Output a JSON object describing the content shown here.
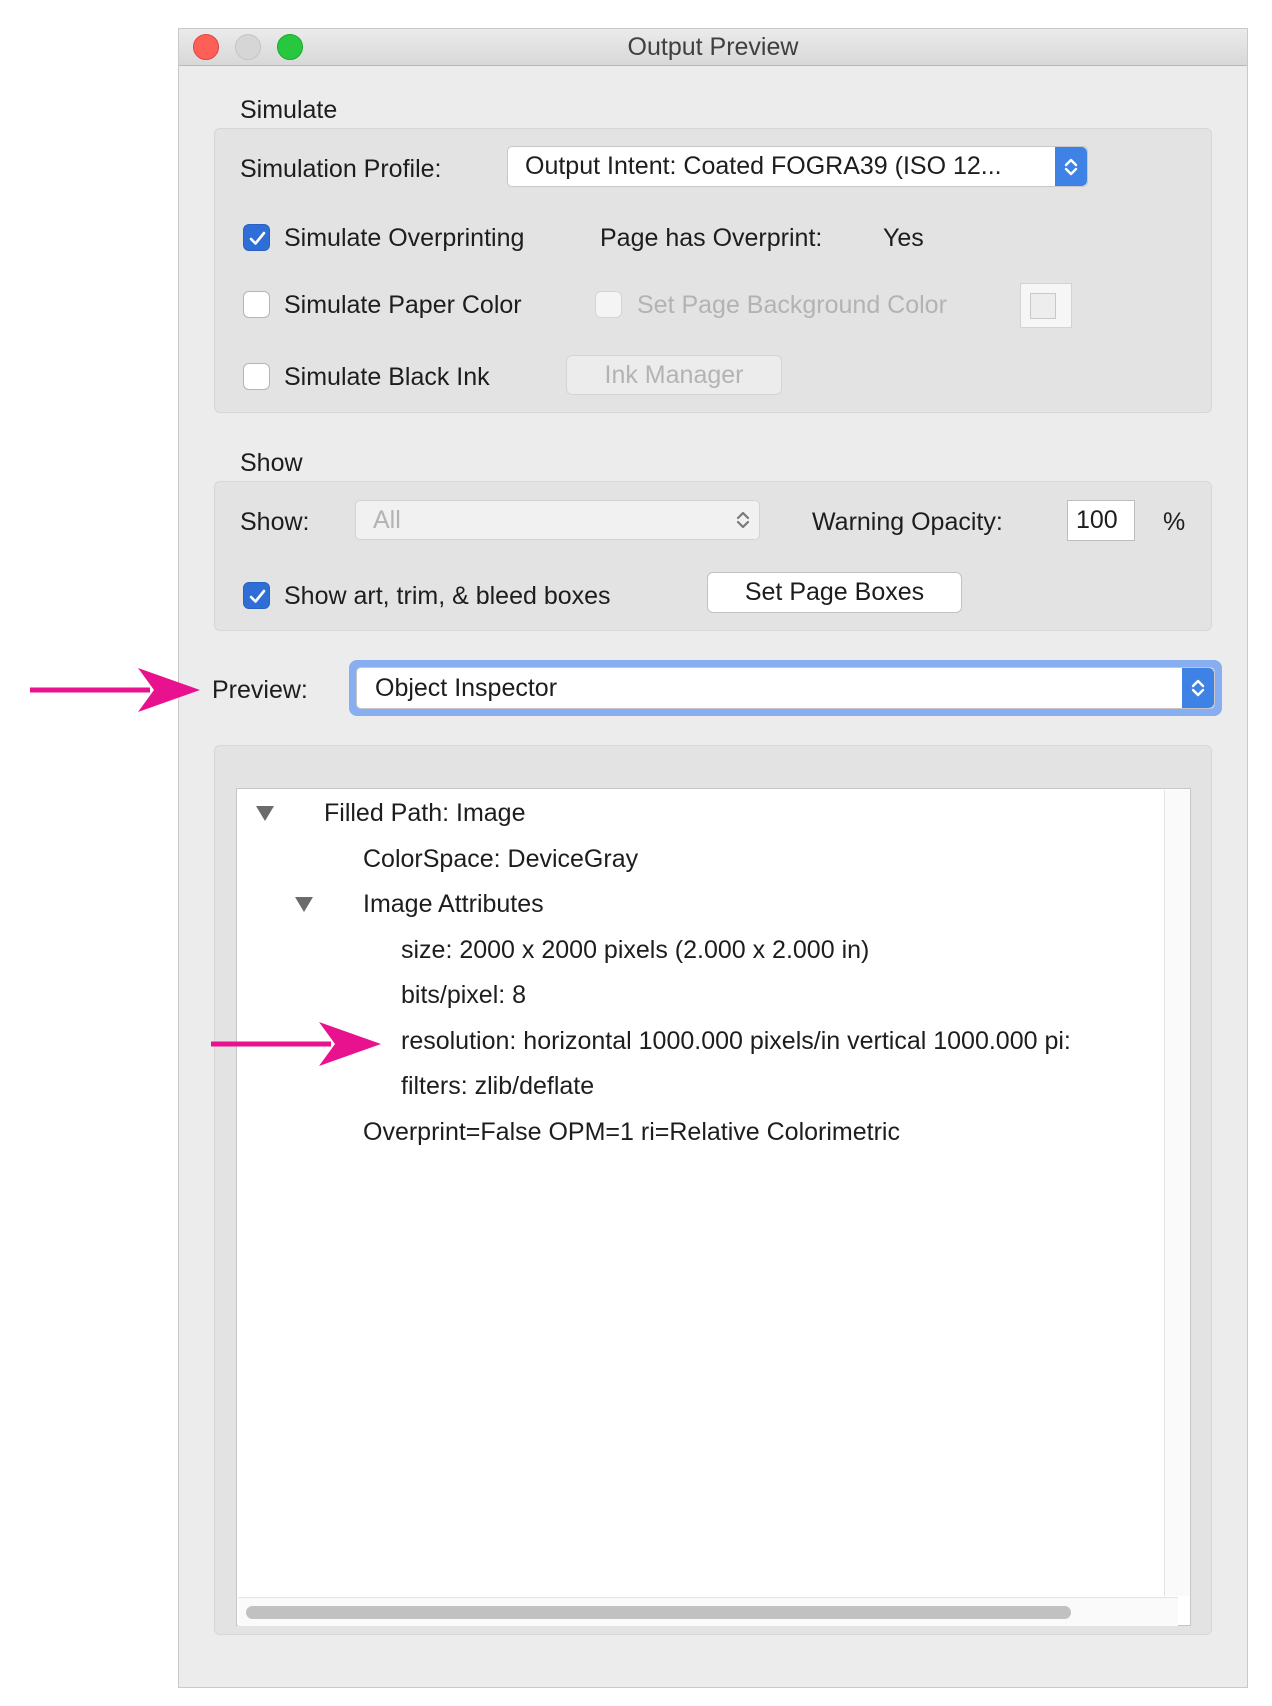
{
  "window": {
    "title": "Output Preview"
  },
  "simulate": {
    "section_label": "Simulate",
    "profile_label": "Simulation Profile:",
    "profile_value": "Output Intent: Coated FOGRA39 (ISO 12...",
    "overprinting": {
      "label": "Simulate Overprinting",
      "checked": true
    },
    "page_has_overprint_label": "Page has Overprint:",
    "page_has_overprint_value": "Yes",
    "paper_color": {
      "label": "Simulate Paper Color",
      "checked": false
    },
    "page_background": {
      "label": "Set Page Background Color",
      "checked": false,
      "enabled": false
    },
    "black_ink": {
      "label": "Simulate Black Ink",
      "checked": false
    },
    "ink_manager_label": "Ink Manager"
  },
  "show": {
    "section_label": "Show",
    "show_label": "Show:",
    "show_value": "All",
    "warning_opacity_label": "Warning Opacity:",
    "warning_opacity_value": "100",
    "percent_label": "%",
    "boxes": {
      "label": "Show art, trim, & bleed boxes",
      "checked": true
    },
    "set_page_boxes_label": "Set Page Boxes"
  },
  "preview": {
    "label": "Preview:",
    "value": "Object Inspector"
  },
  "inspector": {
    "rows": [
      {
        "text": "Filled Path: Image",
        "level": 0,
        "expandable": true
      },
      {
        "text": "ColorSpace: DeviceGray",
        "level": 1,
        "expandable": false
      },
      {
        "text": "Image Attributes",
        "level": 1,
        "expandable": true
      },
      {
        "text": "size: 2000 x 2000 pixels (2.000 x 2.000 in)",
        "level": 2,
        "expandable": false
      },
      {
        "text": "bits/pixel: 8",
        "level": 2,
        "expandable": false
      },
      {
        "text": "resolution: horizontal 1000.000 pixels/in vertical 1000.000 pi:",
        "level": 2,
        "expandable": false
      },
      {
        "text": "filters: zlib/deflate",
        "level": 2,
        "expandable": false
      },
      {
        "text": "Overprint=False OPM=1 ri=Relative Colorimetric",
        "level": 1,
        "expandable": false
      }
    ]
  },
  "colors": {
    "accent": "#3f82e6",
    "checkbox_checked": "#2f6ed6",
    "annotation_arrow": "#e8118e",
    "window_bg": "#ececec"
  },
  "icons": {
    "close": "close-traffic-light",
    "minimize": "minimize-traffic-light",
    "zoom": "zoom-traffic-light",
    "popup_stepper": "up-down-chevron-icon",
    "disclosure_expanded": "disclosure-triangle-down-icon",
    "checkmark": "checkmark-icon",
    "annotation_arrow": "arrow-right-icon"
  }
}
